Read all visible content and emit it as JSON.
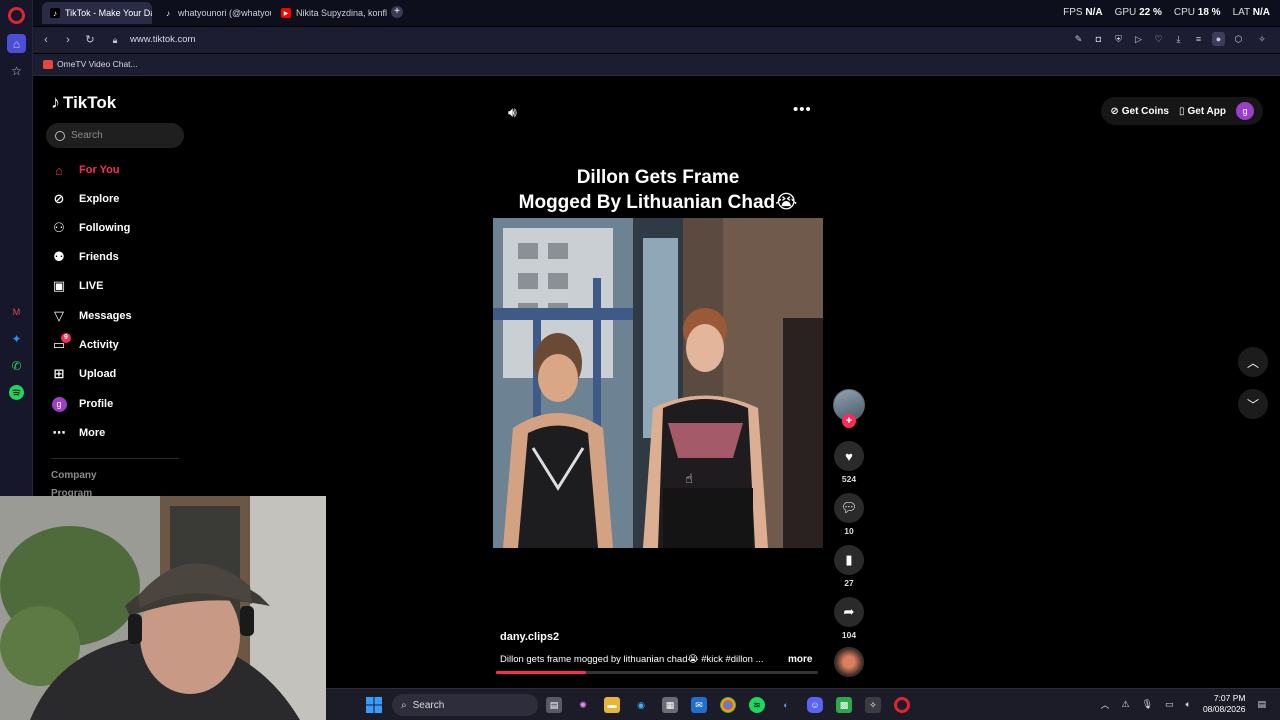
{
  "browser": {
    "tabs": [
      {
        "title": "TikTok - Make Your Day",
        "active": true
      },
      {
        "title": "whatyounori (@whatyoun",
        "active": false
      },
      {
        "title": "Nikita Supyzdina, konflikt",
        "active": false
      }
    ],
    "new_tab_label": "+",
    "url": "www.tiktok.com",
    "bookmark": "OmeTV Video Chat...",
    "hud": {
      "fps_label": "FPS",
      "fps_value": "N/A",
      "gpu_label": "GPU",
      "gpu_value": "22 %",
      "cpu_label": "CPU",
      "cpu_value": "18 %",
      "lat_label": "LAT",
      "lat_value": "N/A"
    }
  },
  "sidebar": {
    "logo": "TikTok",
    "search_placeholder": "Search",
    "items": [
      {
        "label": "For You",
        "icon": "home-icon",
        "active": true
      },
      {
        "label": "Explore",
        "icon": "compass-icon"
      },
      {
        "label": "Following",
        "icon": "following-icon"
      },
      {
        "label": "Friends",
        "icon": "friends-icon"
      },
      {
        "label": "LIVE",
        "icon": "live-icon"
      },
      {
        "label": "Messages",
        "icon": "messages-icon"
      },
      {
        "label": "Activity",
        "icon": "activity-icon",
        "badge": "9"
      },
      {
        "label": "Upload",
        "icon": "upload-icon"
      },
      {
        "label": "Profile",
        "icon": "profile-avatar",
        "avatar_letter": "g"
      },
      {
        "label": "More",
        "icon": "more-icon"
      }
    ],
    "footer": [
      "Company",
      "Program"
    ]
  },
  "header": {
    "get_coins": "Get Coins",
    "get_app": "Get App",
    "avatar_letter": "g"
  },
  "video": {
    "caption_line1": "Dillon Gets Frame",
    "caption_line2": "Mogged By Lithuanian Chad😭",
    "author": "dany.clips2",
    "description": "Dillon gets frame mogged by lithuanian chad😭 #kick #dillon ...",
    "more_label": "more",
    "progress": 0.28,
    "actions": {
      "likes": "524",
      "comments": "10",
      "saves": "27",
      "shares": "104"
    }
  },
  "taskbar": {
    "search_label": "Search",
    "time": "7:07 PM",
    "date": "08/08/2026"
  },
  "colors": {
    "accent": "#fe2c55",
    "browser_bg": "#1c1d31"
  }
}
